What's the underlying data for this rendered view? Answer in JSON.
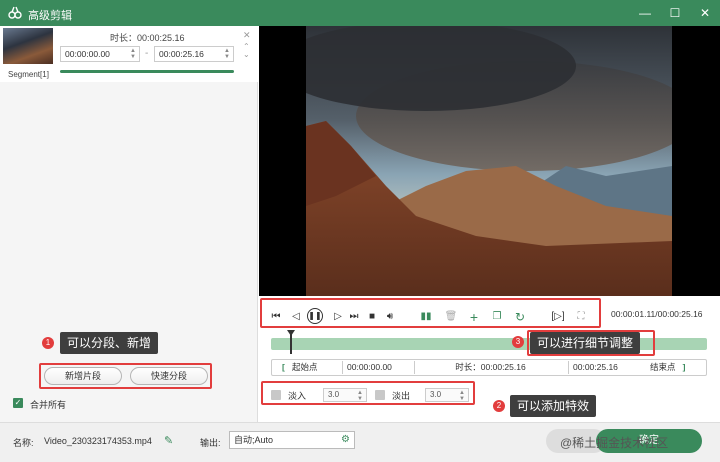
{
  "window": {
    "title": "高级剪辑"
  },
  "segment": {
    "label": "Segment[1]",
    "duration_label": "时长：00:00:25.16",
    "start_value": "00:00:00.00",
    "end_value": "00:00:25.16",
    "separator": "-"
  },
  "left_buttons": {
    "add_segment": "新增片段",
    "quick_split": "快速分段"
  },
  "merge_all": {
    "label": "合并所有",
    "checked": true
  },
  "player": {
    "timecode": "00:00:01.11/00:00:25.16",
    "position_fraction": 0.044
  },
  "range": {
    "start_point_label": "起始点",
    "start_value": "00:00:00.00",
    "duration_label": "时长：00:00:25.16",
    "end_value": "00:00:25.16",
    "end_point_label": "结束点",
    "bracket_left": "[",
    "bracket_right": "]"
  },
  "fades": {
    "fade_in_label": "淡入",
    "fade_in_value": "3.0",
    "fade_out_label": "淡出",
    "fade_out_value": "3.0"
  },
  "tooltips": {
    "t1_num": "1",
    "t1_text": "可以分段、新增",
    "t2_num": "2",
    "t2_text": "可以添加特效",
    "t3_num": "3",
    "t3_text": "可以进行细节调整"
  },
  "bottom": {
    "name_label": "名称:",
    "name_value": "Video_230323174353.mp4",
    "output_label": "输出:",
    "output_value": "自动;Auto",
    "ok_label": "确定",
    "watermark": "@稀土掘金技术社区"
  },
  "colors": {
    "accent": "#3a8a5c",
    "highlight_red": "#e23d3d",
    "track": "#a8d4b4",
    "tooltip_bg": "#3e3e3e"
  },
  "icons": {
    "controls": [
      "skip-to-start-icon",
      "prev-frame-icon",
      "pause-icon",
      "next-frame-icon",
      "skip-to-end-icon",
      "stop-icon",
      "volume-icon",
      "split-icon",
      "delete-icon",
      "add-icon",
      "copy-icon",
      "reset-icon",
      "crop-icon",
      "fullscreen-icon"
    ]
  }
}
